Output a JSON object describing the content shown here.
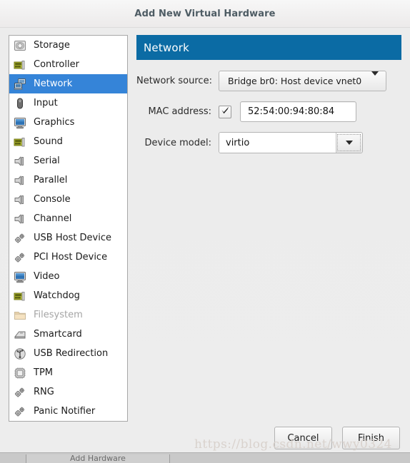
{
  "window": {
    "title": "Add New Virtual Hardware"
  },
  "sidebar": {
    "items": [
      {
        "label": "Storage",
        "icon": "storage-icon",
        "selected": false,
        "disabled": false
      },
      {
        "label": "Controller",
        "icon": "controller-icon",
        "selected": false,
        "disabled": false
      },
      {
        "label": "Network",
        "icon": "network-icon",
        "selected": true,
        "disabled": false
      },
      {
        "label": "Input",
        "icon": "mouse-icon",
        "selected": false,
        "disabled": false
      },
      {
        "label": "Graphics",
        "icon": "monitor-icon",
        "selected": false,
        "disabled": false
      },
      {
        "label": "Sound",
        "icon": "soundcard-icon",
        "selected": false,
        "disabled": false
      },
      {
        "label": "Serial",
        "icon": "serial-port-icon",
        "selected": false,
        "disabled": false
      },
      {
        "label": "Parallel",
        "icon": "parallel-port-icon",
        "selected": false,
        "disabled": false
      },
      {
        "label": "Console",
        "icon": "console-port-icon",
        "selected": false,
        "disabled": false
      },
      {
        "label": "Channel",
        "icon": "channel-port-icon",
        "selected": false,
        "disabled": false
      },
      {
        "label": "USB Host Device",
        "icon": "gears-icon",
        "selected": false,
        "disabled": false
      },
      {
        "label": "PCI Host Device",
        "icon": "gears-icon",
        "selected": false,
        "disabled": false
      },
      {
        "label": "Video",
        "icon": "monitor-icon",
        "selected": false,
        "disabled": false
      },
      {
        "label": "Watchdog",
        "icon": "watchdog-card-icon",
        "selected": false,
        "disabled": false
      },
      {
        "label": "Filesystem",
        "icon": "folder-icon",
        "selected": false,
        "disabled": true
      },
      {
        "label": "Smartcard",
        "icon": "smartcard-icon",
        "selected": false,
        "disabled": false
      },
      {
        "label": "USB Redirection",
        "icon": "usb-icon",
        "selected": false,
        "disabled": false
      },
      {
        "label": "TPM",
        "icon": "chip-icon",
        "selected": false,
        "disabled": false
      },
      {
        "label": "RNG",
        "icon": "gears-icon",
        "selected": false,
        "disabled": false
      },
      {
        "label": "Panic Notifier",
        "icon": "gears-icon",
        "selected": false,
        "disabled": false
      }
    ]
  },
  "panel": {
    "header_title": "Network",
    "header_color": "#0b6ba4",
    "fields": {
      "network_source": {
        "label": "Network source:",
        "value": "Bridge br0: Host device vnet0",
        "arrow_icon": "chevron-down-icon"
      },
      "mac_address": {
        "label": "MAC address:",
        "checked": true,
        "value": "52:54:00:94:80:84",
        "checkbox_icon": "checkmark-icon"
      },
      "device_model": {
        "label": "Device model:",
        "value": "virtio",
        "arrow_icon": "chevron-down-icon"
      }
    }
  },
  "footer": {
    "cancel_label": "Cancel",
    "finish_label": "Finish"
  },
  "watermark": {
    "text": "https://blog.csdn.net/wwy0324"
  },
  "taskbar": {
    "item_label": "Add Hardware"
  }
}
